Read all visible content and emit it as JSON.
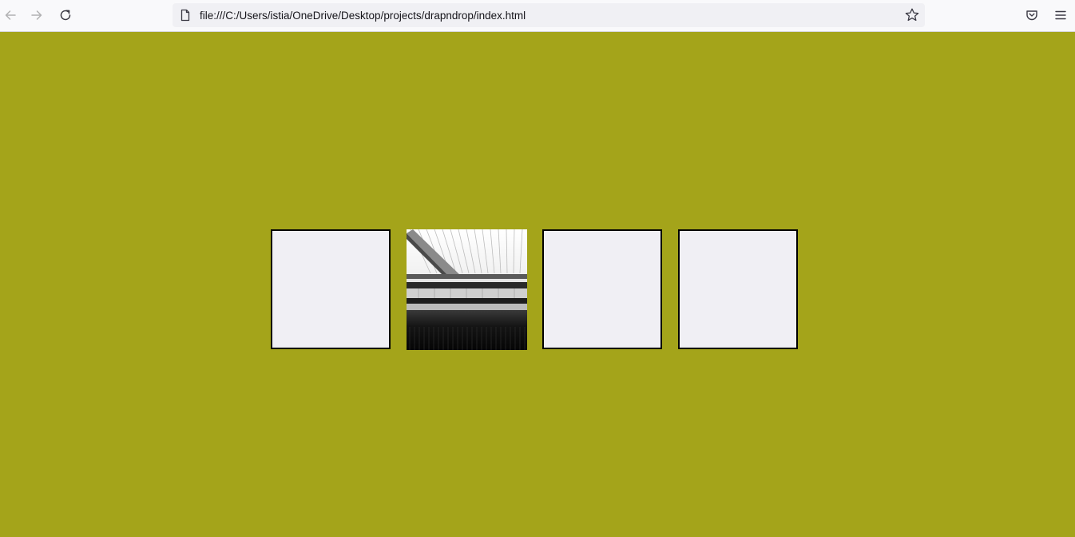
{
  "browser": {
    "url": "file:///C:/Users/istia/OneDrive/Desktop/projects/drapndrop/index.html",
    "icons": {
      "back": "arrow-left-icon",
      "forward": "arrow-right-icon",
      "reload": "reload-icon",
      "page": "page-icon",
      "bookmark": "star-icon",
      "pocket": "pocket-icon",
      "menu": "hamburger-menu-icon"
    }
  },
  "page": {
    "background_color": "#a4a41a",
    "box_fill_color": "#f0eff4",
    "box_border_color": "#000000",
    "boxes": [
      {
        "filled": false
      },
      {
        "filled": true,
        "content": "photo"
      },
      {
        "filled": false
      },
      {
        "filled": false
      }
    ]
  }
}
